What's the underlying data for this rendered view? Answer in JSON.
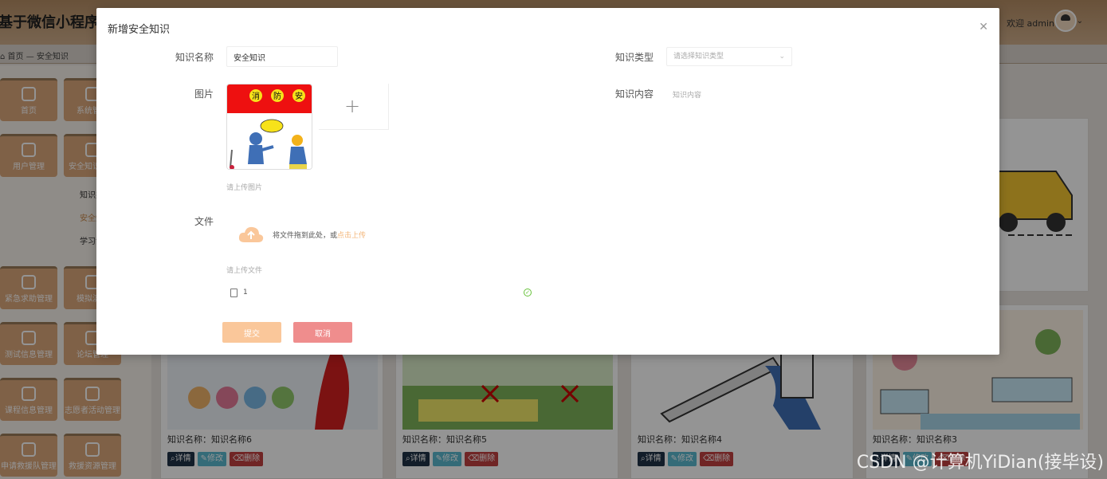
{
  "app": {
    "title": "基于微信小程序",
    "welcome": "欢迎 admin",
    "breadcrumb_home": "首页",
    "breadcrumb_sep": "—",
    "breadcrumb_current": "安全知识"
  },
  "sidebar": {
    "tiles": [
      {
        "label": "首页"
      },
      {
        "label": "系统管理"
      },
      {
        "label": "用户管理"
      },
      {
        "label": "安全知识管理"
      },
      {
        "label": "紧急求助管理"
      },
      {
        "label": "模拟演练"
      },
      {
        "label": "测试信息管理"
      },
      {
        "label": "论坛管理"
      },
      {
        "label": "课程信息管理"
      },
      {
        "label": "志愿者活动管理"
      },
      {
        "label": "申请救援队管理"
      },
      {
        "label": "救援资源管理"
      }
    ],
    "subitems": [
      {
        "label": "知识类型"
      },
      {
        "label": "安全知识"
      },
      {
        "label": "学习记录"
      }
    ]
  },
  "cards": [
    {
      "name": "知识名称：知识名称6"
    },
    {
      "name": "知识名称：知识名称5"
    },
    {
      "name": "知识名称：知识名称4"
    },
    {
      "name": "知识名称：知识名称3"
    }
  ],
  "card_buttons": {
    "detail": "详情",
    "edit": "修改",
    "delete": "删除"
  },
  "modal": {
    "title": "新增安全知识",
    "name_label": "知识名称",
    "name_value": "安全知识",
    "type_label": "知识类型",
    "type_placeholder": "请选择知识类型",
    "image_label": "图片",
    "image_hint": "请上传图片",
    "poster_banner": [
      "消",
      "防",
      "安"
    ],
    "content_label": "知识内容",
    "content_placeholder": "知识内容",
    "file_label": "文件",
    "upload_text": "将文件拖到此处，或",
    "upload_link": "点击上传",
    "file_hint": "请上传文件",
    "file_name": "1",
    "submit_label": "提交",
    "cancel_label": "取消"
  },
  "watermark": "CSDN @计算机YiDian(接毕设)",
  "colors": {
    "accent": "#dba77a",
    "submit": "#fac79a",
    "cancel": "#ef8d8d",
    "upload_link": "#f3b578",
    "success": "#67c23a"
  }
}
